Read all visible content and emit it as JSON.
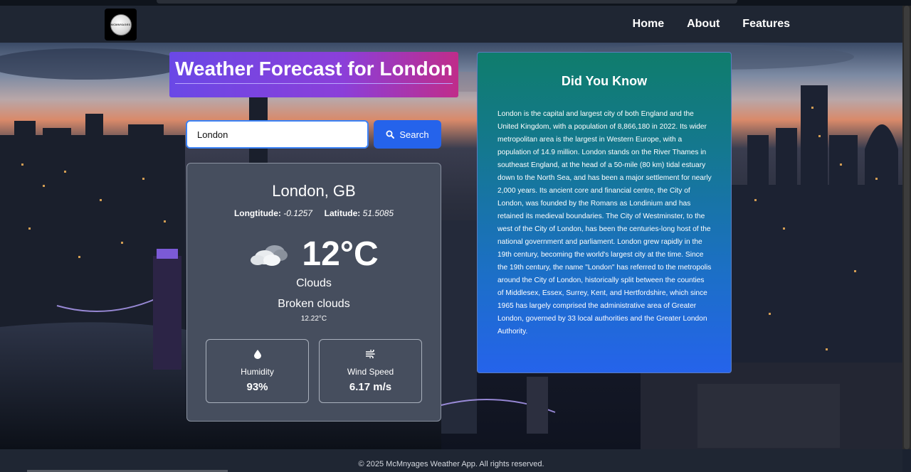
{
  "logo": {
    "text": "MCMNYAGES"
  },
  "nav": {
    "items": [
      "Home",
      "About",
      "Features"
    ]
  },
  "title": "Weather Forecast for London",
  "search": {
    "value": "London",
    "button_label": "Search"
  },
  "weather": {
    "city": "London, GB",
    "longitude_label": "Longtitude:",
    "longitude": "-0.1257",
    "latitude_label": "Latitude:",
    "latitude": "51.5085",
    "temperature": "12°C",
    "condition": "Clouds",
    "description": "Broken clouds",
    "feels": "12.22°C",
    "humidity": {
      "label": "Humidity",
      "value": "93%"
    },
    "wind": {
      "label": "Wind Speed",
      "value": "6.17 m/s"
    }
  },
  "did_you_know": {
    "title": "Did You Know",
    "text": "London is the capital and largest city of both England and the United Kingdom, with a population of 8,866,180 in 2022. Its wider metropolitan area is the largest in Western Europe, with a population of 14.9 million. London stands on the River Thames in southeast England, at the head of a 50-mile (80 km) tidal estuary down to the North Sea, and has been a major settlement for nearly 2,000 years. Its ancient core and financial centre, the City of London, was founded by the Romans as Londinium and has retained its medieval boundaries. The City of Westminster, to the west of the City of London, has been the centuries-long host of the national government and parliament. London grew rapidly in the 19th century, becoming the world's largest city at the time. Since the 19th century, the name \"London\" has referred to the metropolis around the City of London, historically split between the counties of Middlesex, Essex, Surrey, Kent, and Hertfordshire, which since 1965 has largely comprised the administrative area of Greater London, governed by 33 local authorities and the Greater London Authority."
  },
  "footer": "© 2025 McMnyages Weather App. All rights reserved.",
  "colors": {
    "accent": "#2563eb",
    "navbar": "#1f2633",
    "card": "#464e5e",
    "title_gradient_start": "#6a48e6",
    "title_gradient_end": "#c02c8a",
    "dyk_gradient_start": "#0f7d6c",
    "dyk_gradient_end": "#2563eb"
  },
  "icons": {
    "search": "search-icon",
    "weather": "broken-clouds-icon",
    "humidity": "droplet-icon",
    "wind": "wind-icon"
  }
}
